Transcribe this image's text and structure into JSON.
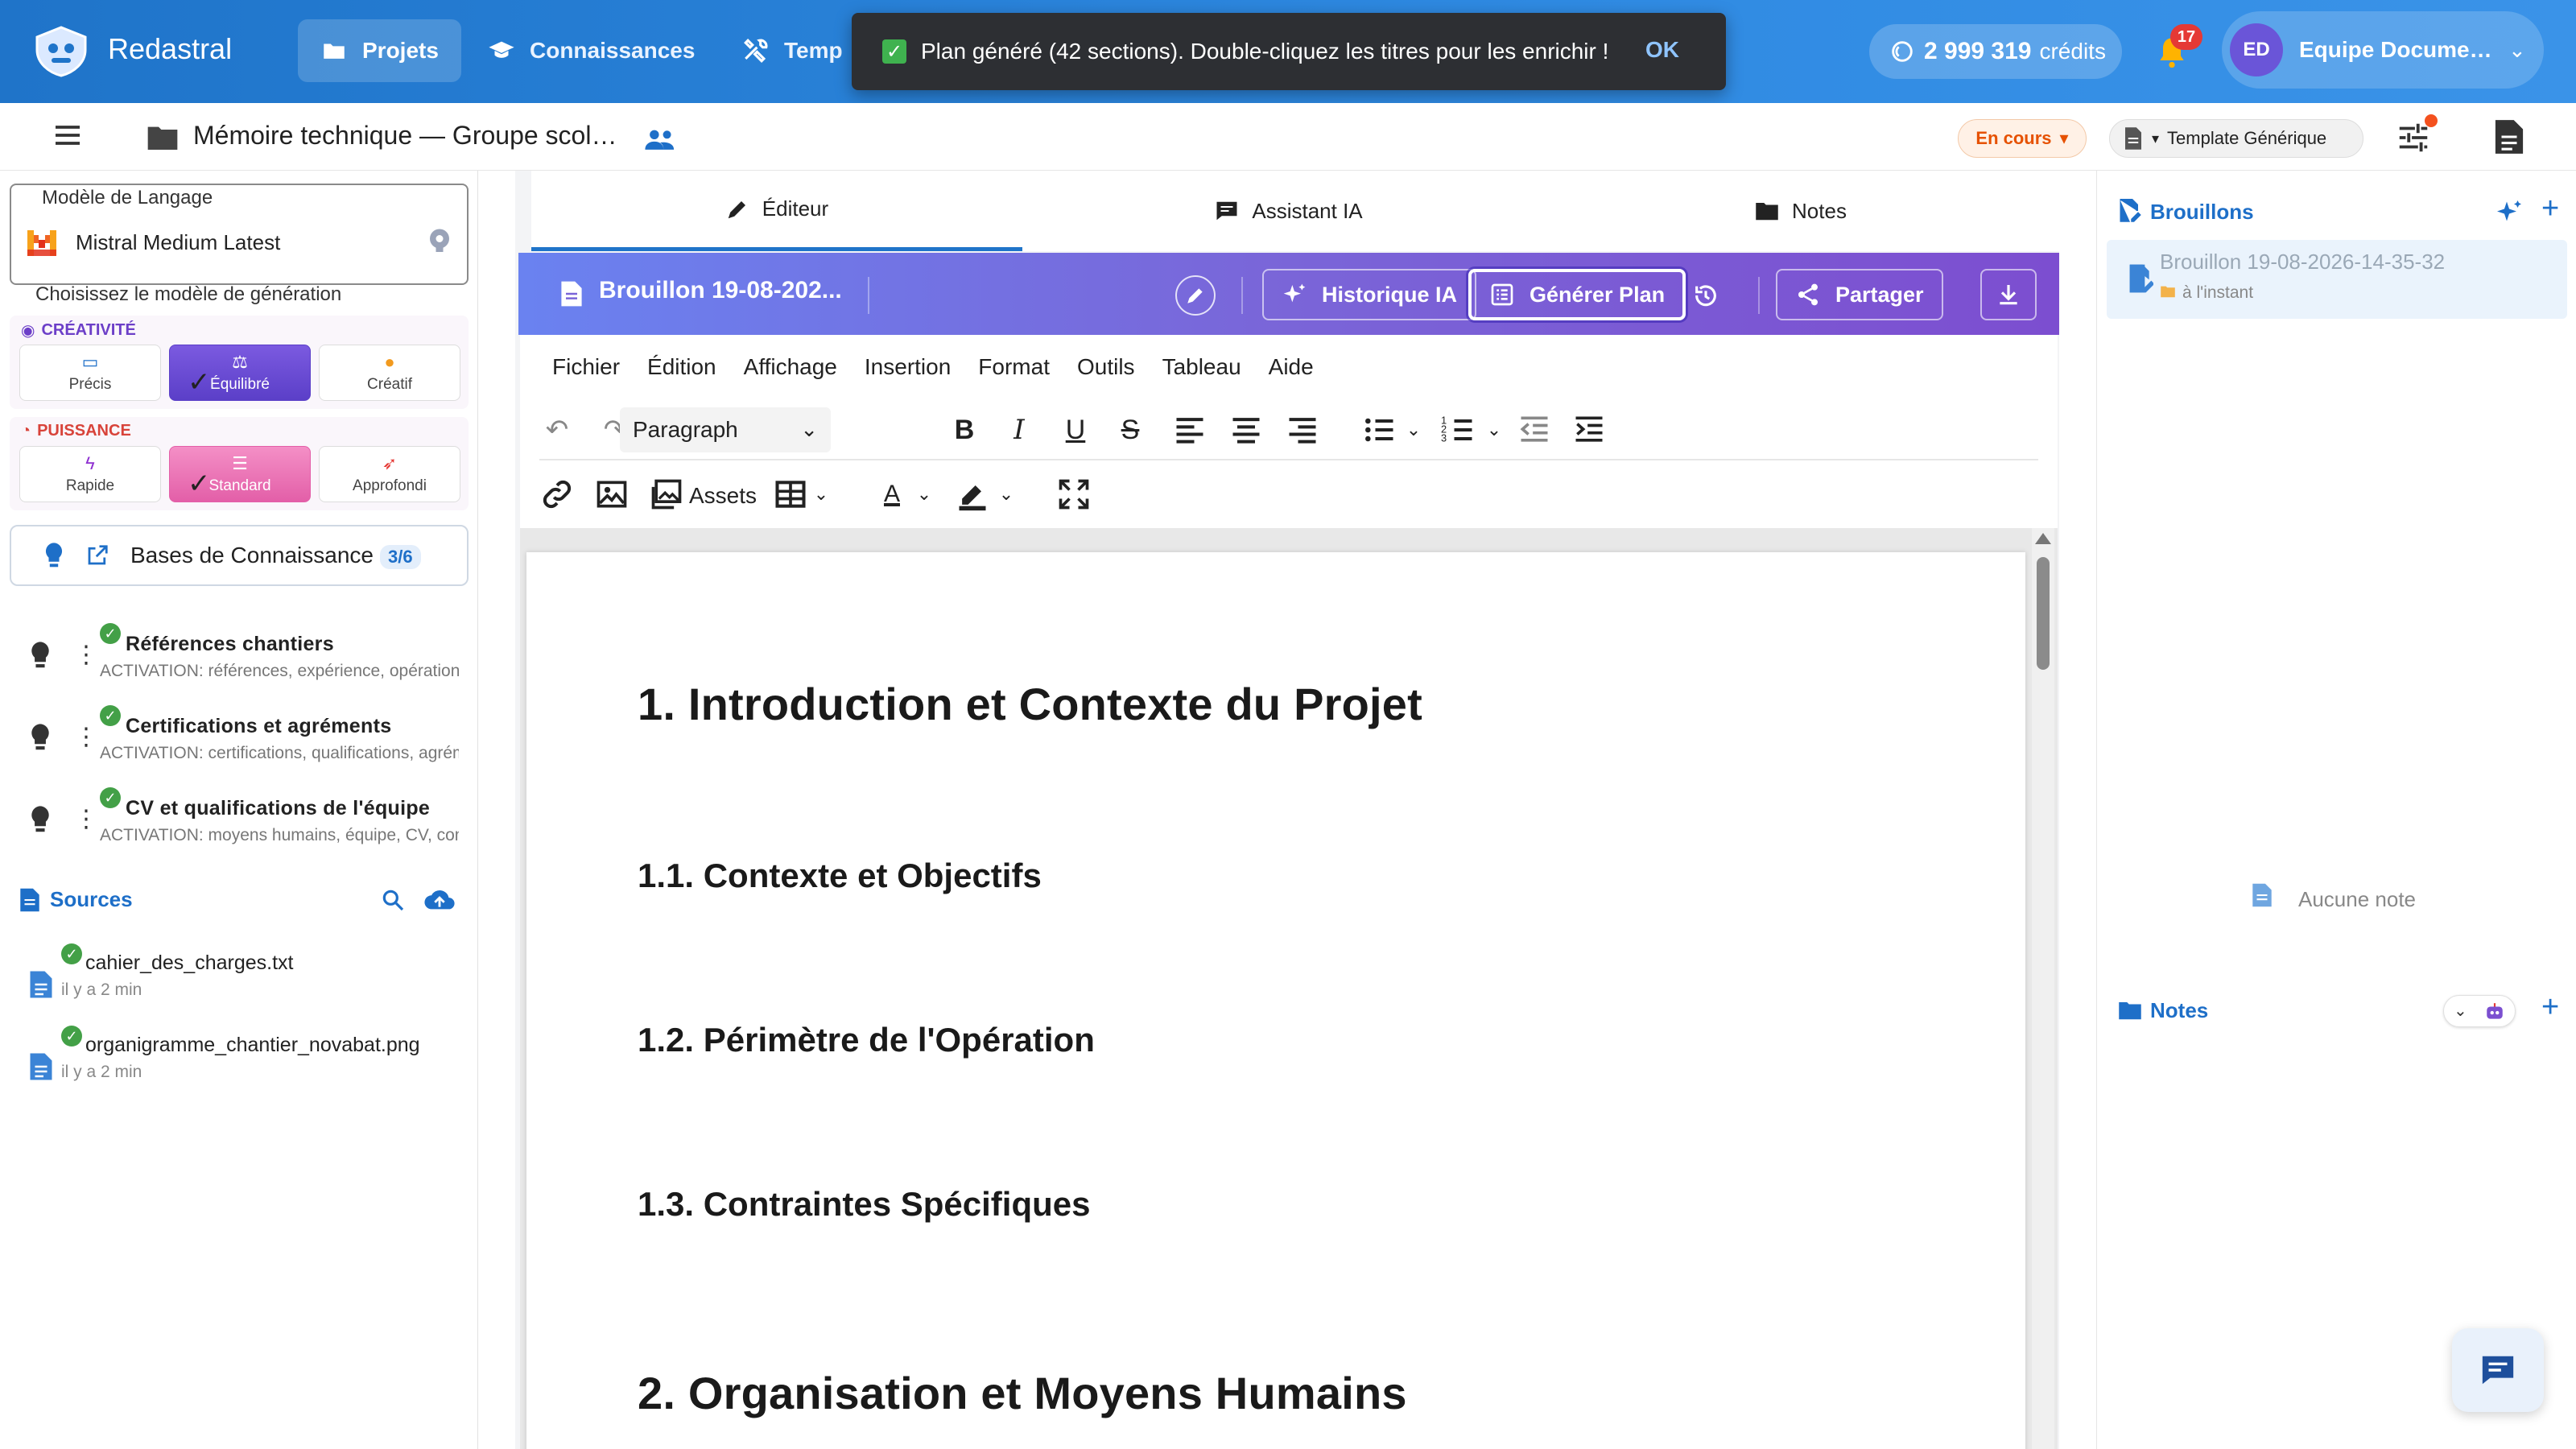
{
  "topbar": {
    "brand": "Redastral",
    "nav": [
      {
        "label": "Projets",
        "icon": "folder-icon",
        "active": true
      },
      {
        "label": "Connaissances",
        "icon": "graduation-cap-icon",
        "active": false
      },
      {
        "label": "Temp",
        "icon": "tools-icon",
        "active": false
      }
    ],
    "toast": {
      "message": "Plan généré (42 sections). Double-cliquez les titres pour les enrichir !",
      "action": "OK"
    },
    "credits": {
      "amount": "2 999 319",
      "unit": "crédits"
    },
    "notifications": "17",
    "user": {
      "initials": "ED",
      "name": "Equipe Documen..."
    }
  },
  "subbar": {
    "project_title": "Mémoire technique — Groupe scolai...",
    "status": "En cours",
    "template": "Template Générique"
  },
  "left": {
    "model_legend": "Modèle de Langage",
    "model_name": "Mistral Medium Latest",
    "model_hint": "Choisissez le modèle de génération",
    "creativity": {
      "title": "CRÉATIVITÉ",
      "options": [
        "Précis",
        "Équilibré",
        "Créatif"
      ],
      "selected": "Équilibré"
    },
    "power": {
      "title": "PUISSANCE",
      "options": [
        "Rapide",
        "Standard",
        "Approfondi"
      ],
      "selected": "Standard"
    },
    "kb": {
      "label": "Bases de Connaissance",
      "count": "3/6"
    },
    "kb_items": [
      {
        "title": "Références chantiers",
        "sub": "ACTIVATION: références, expérience, opérations similaires"
      },
      {
        "title": "Certifications et agréments",
        "sub": "ACTIVATION: certifications, qualifications, agréments"
      },
      {
        "title": "CV et qualifications de l'équipe",
        "sub": "ACTIVATION: moyens humains, équipe, CV, compétences"
      }
    ],
    "sources_title": "Sources",
    "sources": [
      {
        "name": "cahier_des_charges.txt",
        "time": "il y a 2 min"
      },
      {
        "name": "organigramme_chantier_novabat.png",
        "time": "il y a 2 min"
      }
    ]
  },
  "center": {
    "tabs": [
      "Éditeur",
      "Assistant IA",
      "Notes"
    ],
    "draft_name": "Brouillon 19-08-202...",
    "buttons": {
      "history": "Historique IA",
      "plan": "Générer Plan",
      "share": "Partager"
    },
    "menu": [
      "Fichier",
      "Édition",
      "Affichage",
      "Insertion",
      "Format",
      "Outils",
      "Tableau",
      "Aide"
    ],
    "block_format": "Paragraph",
    "assets_label": "Assets",
    "doc": [
      {
        "level": 1,
        "text": "1. Introduction et Contexte du Projet"
      },
      {
        "level": 2,
        "text": "1.1. Contexte et Objectifs"
      },
      {
        "level": 2,
        "text": "1.2. Périmètre de l'Opération"
      },
      {
        "level": 2,
        "text": "1.3. Contraintes Spécifiques"
      },
      {
        "level": 1,
        "text": "2. Organisation et Moyens Humains"
      }
    ]
  },
  "right": {
    "drafts_title": "Brouillons",
    "draft": {
      "name": "Brouillon 19-08-2026-14-35-32",
      "time": "à l'instant"
    },
    "notes_title": "Notes",
    "notes_empty": "Aucune note"
  }
}
